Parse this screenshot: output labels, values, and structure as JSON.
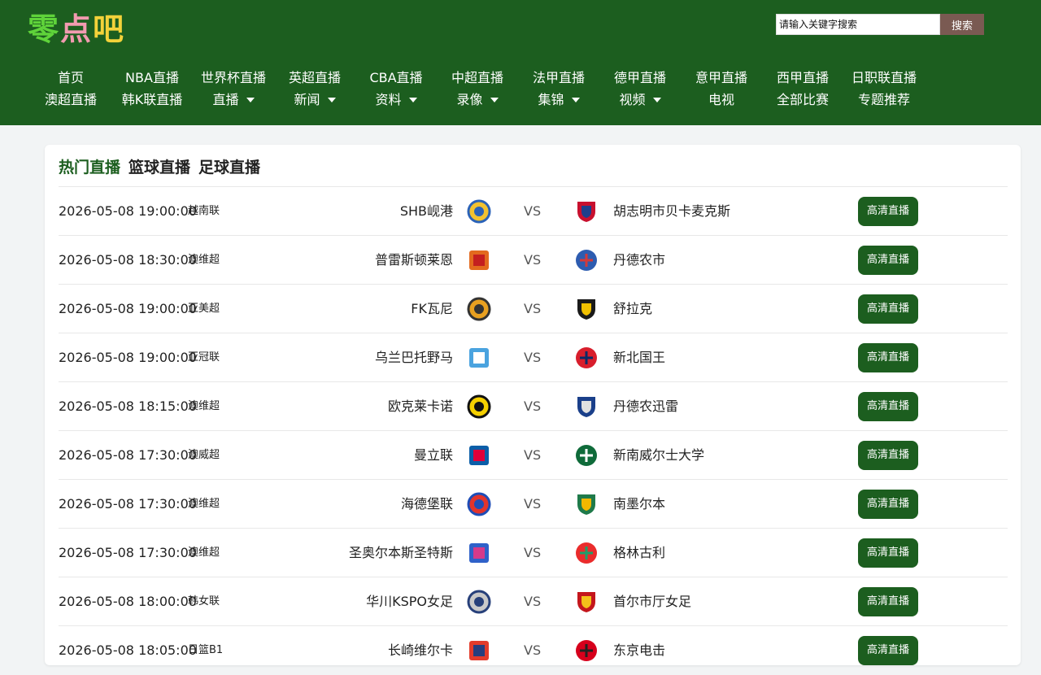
{
  "logo": {
    "char1": "零",
    "char2": "点",
    "char3": "吧"
  },
  "search": {
    "placeholder": "请输入关键字搜索",
    "button": "搜索"
  },
  "nav": [
    {
      "top": "首页",
      "bottom": "澳超直播",
      "dropdown": false
    },
    {
      "top": "NBA直播",
      "bottom": "韩K联直播",
      "dropdown": false
    },
    {
      "top": "世界杯直播",
      "bottom": "直播",
      "dropdown": true
    },
    {
      "top": "英超直播",
      "bottom": "新闻",
      "dropdown": true
    },
    {
      "top": "CBA直播",
      "bottom": "资料",
      "dropdown": true
    },
    {
      "top": "中超直播",
      "bottom": "录像",
      "dropdown": true
    },
    {
      "top": "法甲直播",
      "bottom": "集锦",
      "dropdown": true
    },
    {
      "top": "德甲直播",
      "bottom": "视频",
      "dropdown": true
    },
    {
      "top": "意甲直播",
      "bottom": "电视",
      "dropdown": false
    },
    {
      "top": "西甲直播",
      "bottom": "全部比赛",
      "dropdown": false
    },
    {
      "top": "日职联直播",
      "bottom": "专题推荐",
      "dropdown": false
    }
  ],
  "tabs": [
    "热门直播",
    "篮球直播",
    "足球直播"
  ],
  "vs_label": "VS",
  "button_label": "高清直播",
  "colors": {
    "brand_green": "#1c5e1f",
    "search_button": "#7a5a52"
  },
  "matches": [
    {
      "time": "2026-05-08 19:00:00",
      "league": "越南联",
      "home": "SHB岘港",
      "away": "胡志明市贝卡麦克斯",
      "home_icon": "shb-danang-crest-icon",
      "away_icon": "becamex-crest-icon"
    },
    {
      "time": "2026-05-08 18:30:00",
      "league": "澳维超",
      "home": "普雷斯顿莱恩",
      "away": "丹德农市",
      "home_icon": "preston-lions-crest-icon",
      "away_icon": "dandenong-city-crest-icon"
    },
    {
      "time": "2026-05-08 19:00:00",
      "league": "亚美超",
      "home": "FK瓦尼",
      "away": "舒拉克",
      "home_icon": "fc-van-crest-icon",
      "away_icon": "shirak-crest-icon"
    },
    {
      "time": "2026-05-08 19:00:00",
      "league": "亚冠联",
      "home": "乌兰巴托野马",
      "away": "新北国王",
      "home_icon": "ulaanbaatar-broncos-crest-icon",
      "away_icon": "new-taipei-kings-crest-icon"
    },
    {
      "time": "2026-05-08 18:15:00",
      "league": "澳维超",
      "home": "欧克莱卡诺",
      "away": "丹德农迅雷",
      "home_icon": "oakleigh-cannons-crest-icon",
      "away_icon": "dandenong-thunder-crest-icon"
    },
    {
      "time": "2026-05-08 17:30:00",
      "league": "澳威超",
      "home": "曼立联",
      "away": "新南威尔士大学",
      "home_icon": "manly-united-crest-icon",
      "away_icon": "unsw-crest-icon"
    },
    {
      "time": "2026-05-08 17:30:00",
      "league": "澳维超",
      "home": "海德堡联",
      "away": "南墨尔本",
      "home_icon": "heidelberg-united-crest-icon",
      "away_icon": "south-melbourne-crest-icon"
    },
    {
      "time": "2026-05-08 17:30:00",
      "league": "澳维超",
      "home": "圣奥尔本斯圣特斯",
      "away": "格林古利",
      "home_icon": "st-albans-saints-crest-icon",
      "away_icon": "green-gully-crest-icon"
    },
    {
      "time": "2026-05-08 18:00:00",
      "league": "韩女联",
      "home": "华川KSPO女足",
      "away": "首尔市厅女足",
      "home_icon": "hwacheon-kspo-crest-icon",
      "away_icon": "seoul-city-crest-icon"
    },
    {
      "time": "2026-05-08 18:05:00",
      "league": "日篮B1",
      "home": "长崎维尔卡",
      "away": "东京电击",
      "home_icon": "nagasaki-velca-crest-icon",
      "away_icon": "alvark-tokyo-crest-icon"
    }
  ]
}
